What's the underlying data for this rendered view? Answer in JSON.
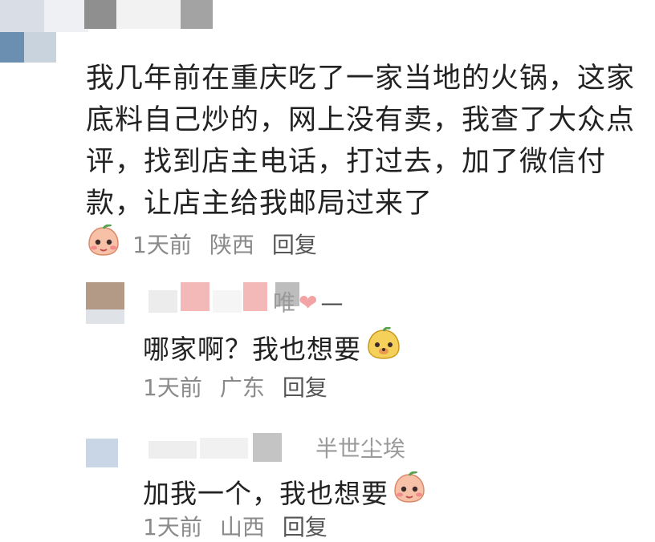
{
  "comments": [
    {
      "text": "我几年前在重庆吃了一家当地的火锅，这家底料自己炒的，网上没有卖，我查了大众点评，找到店主电话，打过去，加了微信付款，让店主给我邮局过来了",
      "time": "1天前",
      "location": "陕西",
      "reply_label": "回复",
      "emoji": "peach-blush-emoji"
    }
  ],
  "replies": [
    {
      "username": "唯",
      "text": "哪家啊？我也想要",
      "time": "1天前",
      "location": "广东",
      "reply_label": "回复",
      "emoji": "yellow-dog-emoji"
    },
    {
      "username": "半世尘埃",
      "text": "加我一个，我也想要",
      "time": "1天前",
      "location": "山西",
      "reply_label": "回复",
      "emoji": "peach-blush-emoji"
    }
  ],
  "colors": {
    "text": "#222222",
    "meta": "#8a8a8a",
    "username": "#9a9a9a",
    "mosaic_pink": "#f3b9b9",
    "mosaic_gray": "#bdbdbd"
  }
}
